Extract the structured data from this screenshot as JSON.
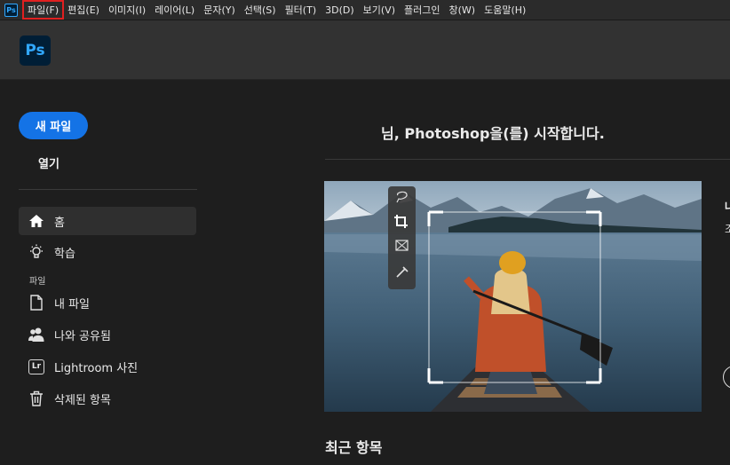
{
  "app": {
    "mini_logo": "Ps",
    "logo": "Ps"
  },
  "menu": [
    {
      "label": "파일(F)",
      "active": true
    },
    {
      "label": "편집(E)"
    },
    {
      "label": "이미지(I)"
    },
    {
      "label": "레이어(L)"
    },
    {
      "label": "문자(Y)"
    },
    {
      "label": "선택(S)"
    },
    {
      "label": "필터(T)"
    },
    {
      "label": "3D(D)"
    },
    {
      "label": "보기(V)"
    },
    {
      "label": "플러그인"
    },
    {
      "label": "창(W)"
    },
    {
      "label": "도움말(H)"
    }
  ],
  "sidebar": {
    "new_file": "새 파일",
    "open": "열기",
    "nav_top": [
      {
        "label": "홈",
        "icon": "home-icon",
        "active": true
      },
      {
        "label": "학습",
        "icon": "lightbulb-icon"
      }
    ],
    "files_section": "파일",
    "nav_files": [
      {
        "label": "내 파일",
        "icon": "document-icon"
      },
      {
        "label": "나와 공유됨",
        "icon": "people-icon"
      },
      {
        "label": "Lightroom 사진",
        "icon": "lightroom-icon",
        "badge": "Lr"
      },
      {
        "label": "삭제된 항목",
        "icon": "trash-icon"
      }
    ]
  },
  "main": {
    "welcome": "님, Photoshop을(를) 시작합니다.",
    "hero_side_title": "나",
    "hero_side_text": "조",
    "recent_title": "최근 항목"
  },
  "colors": {
    "accent": "#1473e6",
    "ps_blue": "#31a8ff",
    "highlight_outline": "#e02020"
  }
}
